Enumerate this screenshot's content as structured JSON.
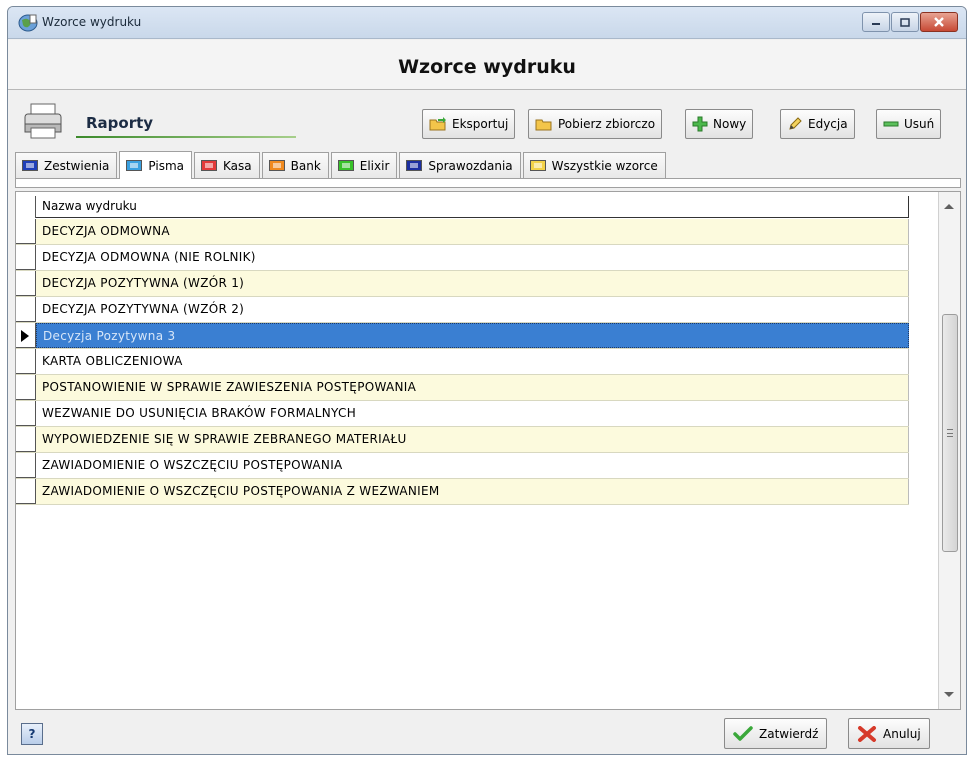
{
  "window": {
    "title": "Wzorce wydruku"
  },
  "headline": "Wzorce wydruku",
  "toolbar": {
    "section_title": "Raporty",
    "buttons": {
      "export": "Eksportuj",
      "fetch_all": "Pobierz zbiorczo",
      "new": "Nowy",
      "edit": "Edycja",
      "delete": "Usuń"
    }
  },
  "tabs": [
    {
      "label": "Zestwienia",
      "color": "#1f3fb8"
    },
    {
      "label": "Pisma",
      "color": "#3aa0e0"
    },
    {
      "label": "Kasa",
      "color": "#e23a3a"
    },
    {
      "label": "Bank",
      "color": "#f08a1f"
    },
    {
      "label": "Elixir",
      "color": "#39c22a"
    },
    {
      "label": "Sprawozdania",
      "color": "#1c2fa0"
    },
    {
      "label": "Wszystkie wzorce",
      "color": "#f3d24a"
    }
  ],
  "active_tab": "Pisma",
  "grid": {
    "column_header": "Nazwa wydruku",
    "rows": [
      "DECYZJA ODMOWNA",
      "DECYZJA ODMOWNA (NIE ROLNIK)",
      "DECYZJA POZYTYWNA (WZÓR 1)",
      "DECYZJA POZYTYWNA (WZÓR 2)",
      "Decyzja Pozytywna 3",
      "KARTA OBLICZENIOWA",
      "POSTANOWIENIE W SPRAWIE ZAWIESZENIA POSTĘPOWANIA",
      "WEZWANIE DO USUNIĘCIA BRAKÓW FORMALNYCH",
      "WYPOWIEDZENIE SIĘ W SPRAWIE ZEBRANEGO MATERIAŁU",
      "ZAWIADOMIENIE O WSZCZĘCIU POSTĘPOWANIA",
      "ZAWIADOMIENIE O WSZCZĘCIU POSTĘPOWANIA Z WEZWANIEM"
    ],
    "selected_row": "Decyzja Pozytywna 3"
  },
  "footer": {
    "help": "?",
    "confirm": "Zatwierdź",
    "cancel": "Anuluj"
  }
}
